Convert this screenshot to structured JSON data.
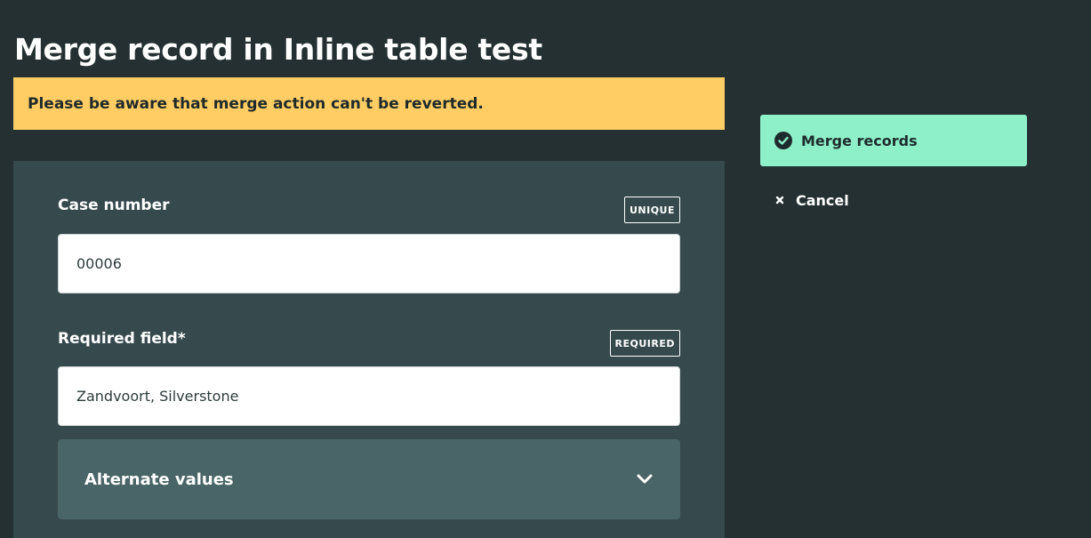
{
  "page": {
    "title": "Merge record in Inline table test"
  },
  "warning": {
    "text": "Please be aware that merge action can't be reverted."
  },
  "fields": [
    {
      "label": "Case number",
      "badge": "UNIQUE",
      "value": "00006"
    },
    {
      "label": "Required field*",
      "badge": "REQUIRED",
      "value": "Zandvoort, Silverstone"
    }
  ],
  "alternate_values": {
    "label": "Alternate values"
  },
  "actions": {
    "merge_label": "Merge records",
    "cancel_label": "Cancel"
  },
  "icons": {
    "merge": "check-circle-icon",
    "cancel": "close-icon",
    "expand": "chevron-down-icon"
  },
  "colors": {
    "background": "#243031",
    "panel": "#364a4d",
    "warning": "#ffcd63",
    "accent": "#8ef0c9",
    "alternate_panel": "#4a6567"
  }
}
